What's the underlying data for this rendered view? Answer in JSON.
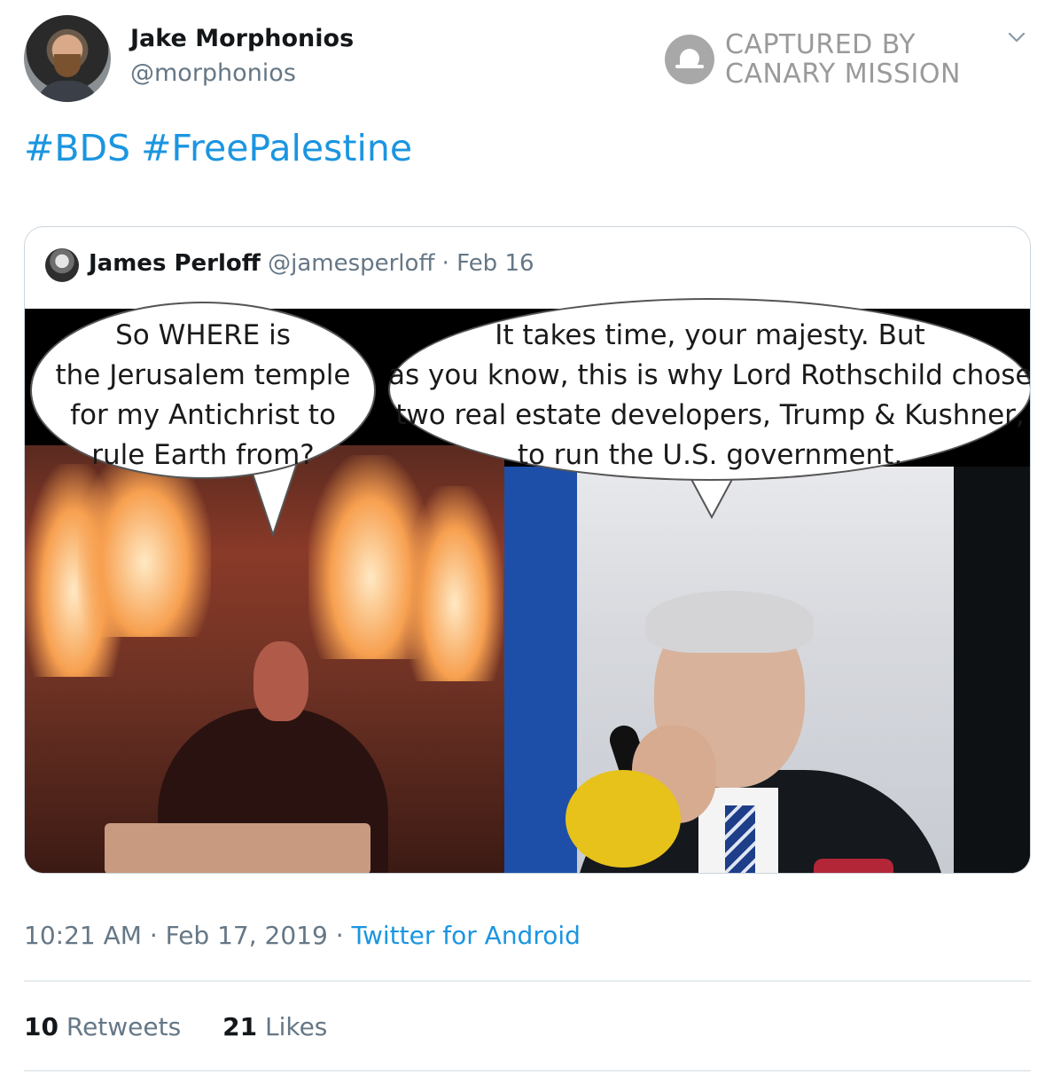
{
  "author": {
    "name": "Jake Morphonios",
    "handle": "@morphonios"
  },
  "watermark": {
    "line1": "CAPTURED BY",
    "line2": "CANARY MISSION"
  },
  "tweet": {
    "hashtags": [
      "#BDS",
      "#FreePalestine"
    ]
  },
  "quoted_tweet": {
    "name": "James Perloff",
    "handle": "@jamesperloff",
    "date": "· Feb 16",
    "image": {
      "left_bubble": [
        "So WHERE is",
        "the Jerusalem temple",
        "for my Antichrist to",
        "rule Earth from?"
      ],
      "right_bubble": [
        "It takes time, your majesty. But",
        "as you know, this is why Lord Rothschild chose",
        "two real estate developers, Trump & Kushner,",
        "to run the U.S. government."
      ]
    }
  },
  "meta": {
    "time": "10:21 AM",
    "date": "Feb 17, 2019",
    "source": "Twitter for Android"
  },
  "stats": {
    "retweets_count": "10",
    "retweets_label": "Retweets",
    "likes_count": "21",
    "likes_label": "Likes"
  }
}
